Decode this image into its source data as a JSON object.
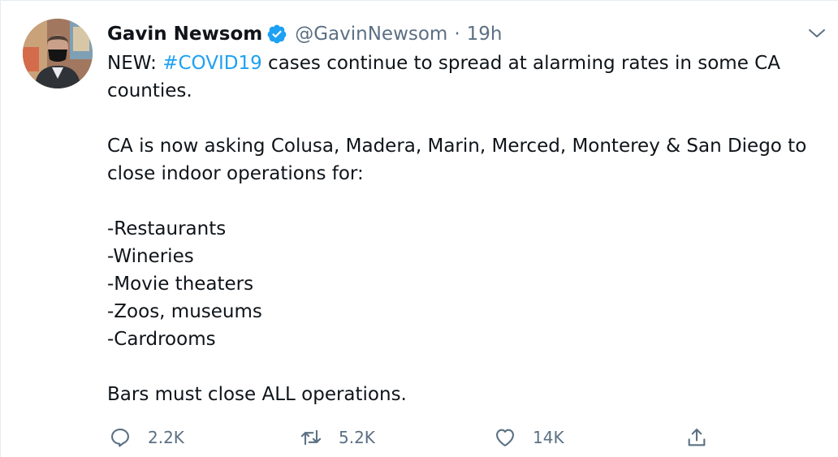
{
  "tweet": {
    "display_name": "Gavin Newsom",
    "handle": "@GavinNewsom",
    "separator": "·",
    "time": "19h",
    "body": {
      "line1_prefix": "NEW: ",
      "hashtag": "#COVID19",
      "line1_suffix": " cases continue to spread at alarming rates in some CA counties.",
      "para2": "CA is now asking Colusa, Madera, Marin, Merced, Monterey & San Diego to close indoor operations for:",
      "list": [
        "-Restaurants",
        "-Wineries",
        "-Movie theaters",
        "-Zoos, museums",
        "-Cardrooms"
      ],
      "para4": "Bars must close ALL operations."
    },
    "actions": {
      "reply_count": "2.2K",
      "retweet_count": "5.2K",
      "like_count": "14K"
    }
  },
  "icons": {
    "verified": "verified-badge-icon",
    "caret": "chevron-down-icon",
    "reply": "reply-icon",
    "retweet": "retweet-icon",
    "like": "heart-icon",
    "share": "share-icon"
  },
  "colors": {
    "accent": "#1da1f2",
    "text": "#0f1419",
    "muted": "#5b7083"
  }
}
